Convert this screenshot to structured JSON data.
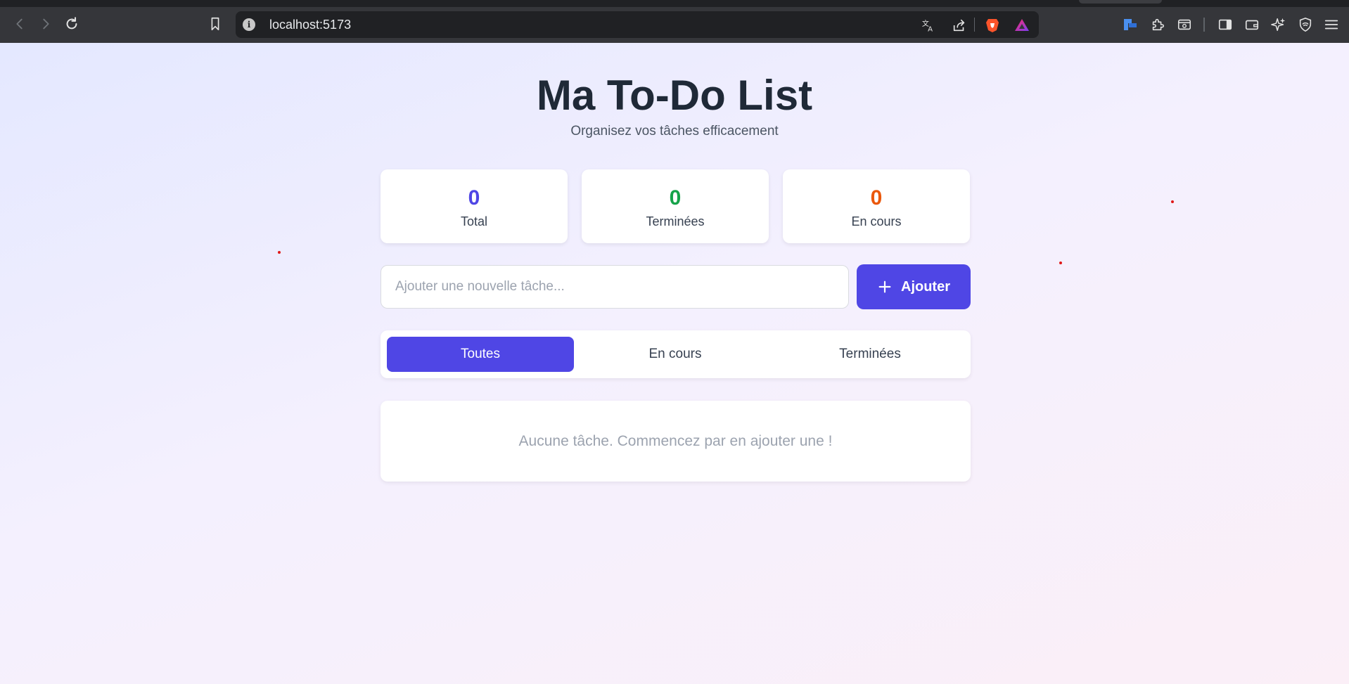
{
  "browser": {
    "url": "localhost:5173",
    "icons": {
      "back": "arrow-left-icon",
      "forward": "arrow-right-icon",
      "reload": "reload-icon",
      "bookmark": "bookmark-icon",
      "site_info": "info-icon",
      "translate": "translate-icon",
      "share": "share-icon",
      "brave_shields": "brave-lion-icon",
      "brave_rewards": "rewards-triangle-icon",
      "toolbar_extension": "extension-puzzle-icon",
      "sidebar": "sidebar-icon",
      "wallet": "wallet-icon",
      "leo": "sparkle-icon",
      "vpn": "vpn-shield-icon",
      "menu": "hamburger-menu-icon"
    },
    "info_glyph": "i"
  },
  "app": {
    "title": "Ma To-Do List",
    "subtitle": "Organisez vos tâches efficacement",
    "stats": [
      {
        "value": "0",
        "label": "Total",
        "color": "#4f46e5"
      },
      {
        "value": "0",
        "label": "Terminées",
        "color": "#16a34a"
      },
      {
        "value": "0",
        "label": "En cours",
        "color": "#ea580c"
      }
    ],
    "input": {
      "placeholder": "Ajouter une nouvelle tâche...",
      "value": ""
    },
    "add_button": {
      "label": "Ajouter"
    },
    "tabs": [
      {
        "label": "Toutes",
        "active": true
      },
      {
        "label": "En cours",
        "active": false
      },
      {
        "label": "Terminées",
        "active": false
      }
    ],
    "empty_message": "Aucune tâche. Commencez par en ajouter une !",
    "accent_color": "#4f46e5"
  }
}
